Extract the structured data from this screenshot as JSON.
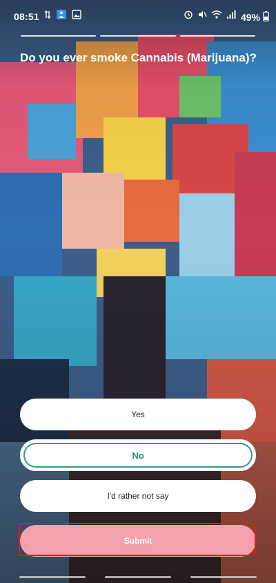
{
  "status_bar": {
    "time": "08:51",
    "battery_percent": "49%",
    "left_icons": [
      "sync-arrows-icon",
      "person-icon",
      "image-icon"
    ],
    "right_icons": [
      "alarm-icon",
      "mute-icon",
      "wifi-icon",
      "signal-icon"
    ]
  },
  "progress": {
    "segments_total": 3,
    "segments_complete": 3
  },
  "question": {
    "text": "Do you ever smoke Cannabis (Marijuana)?"
  },
  "options": [
    {
      "label": "Yes",
      "selected": false
    },
    {
      "label": "No",
      "selected": true
    },
    {
      "label": "I'd rather not say",
      "selected": false
    }
  ],
  "submit": {
    "label": "Submit"
  },
  "colors": {
    "accent_teal": "#2b9c8f",
    "submit_pink": "#f5a0ad",
    "highlight_red": "#e01b1b"
  }
}
